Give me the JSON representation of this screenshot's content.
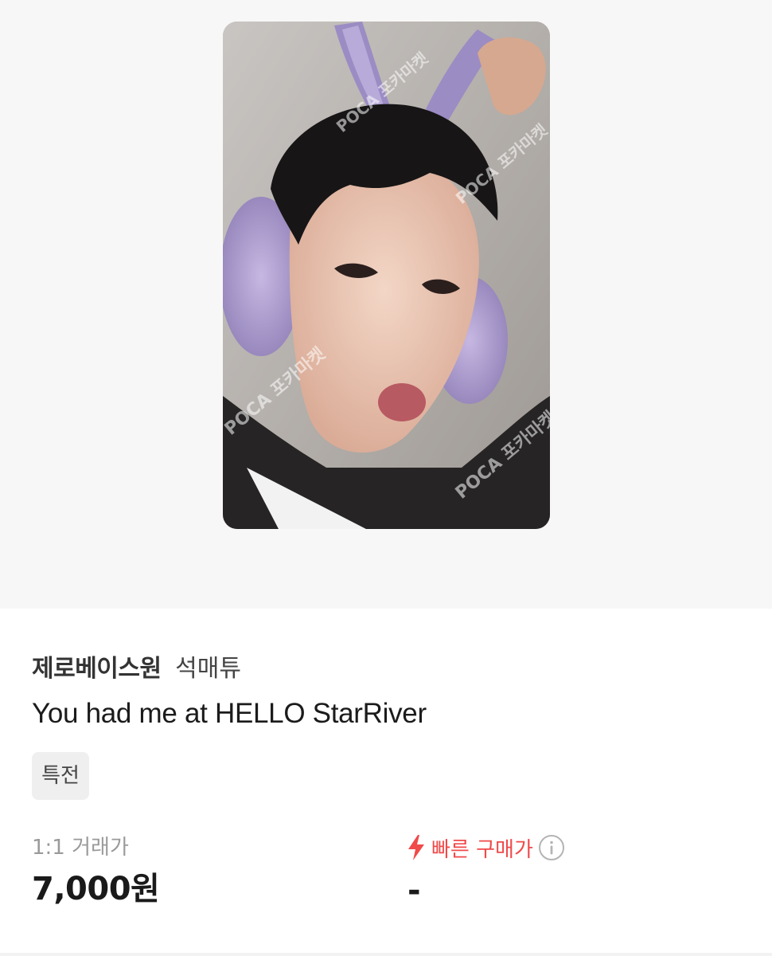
{
  "product": {
    "image_alt": "photocard-selfie-with-bunny-ears",
    "watermark": "POCA 포카마켓"
  },
  "info": {
    "group_name": "제로베이스원",
    "member_name": "석매튜",
    "album_title": "You had me at HELLO StarRiver",
    "tag": "특전"
  },
  "pricing": {
    "trade_label": "1:1 거래가",
    "trade_value": "7,000원",
    "quick_label": "빠른 구매가",
    "quick_value": "-",
    "quick_icon": "lightning-icon",
    "info_icon": "info-circle-icon",
    "accent_color": "#f04a4a"
  }
}
